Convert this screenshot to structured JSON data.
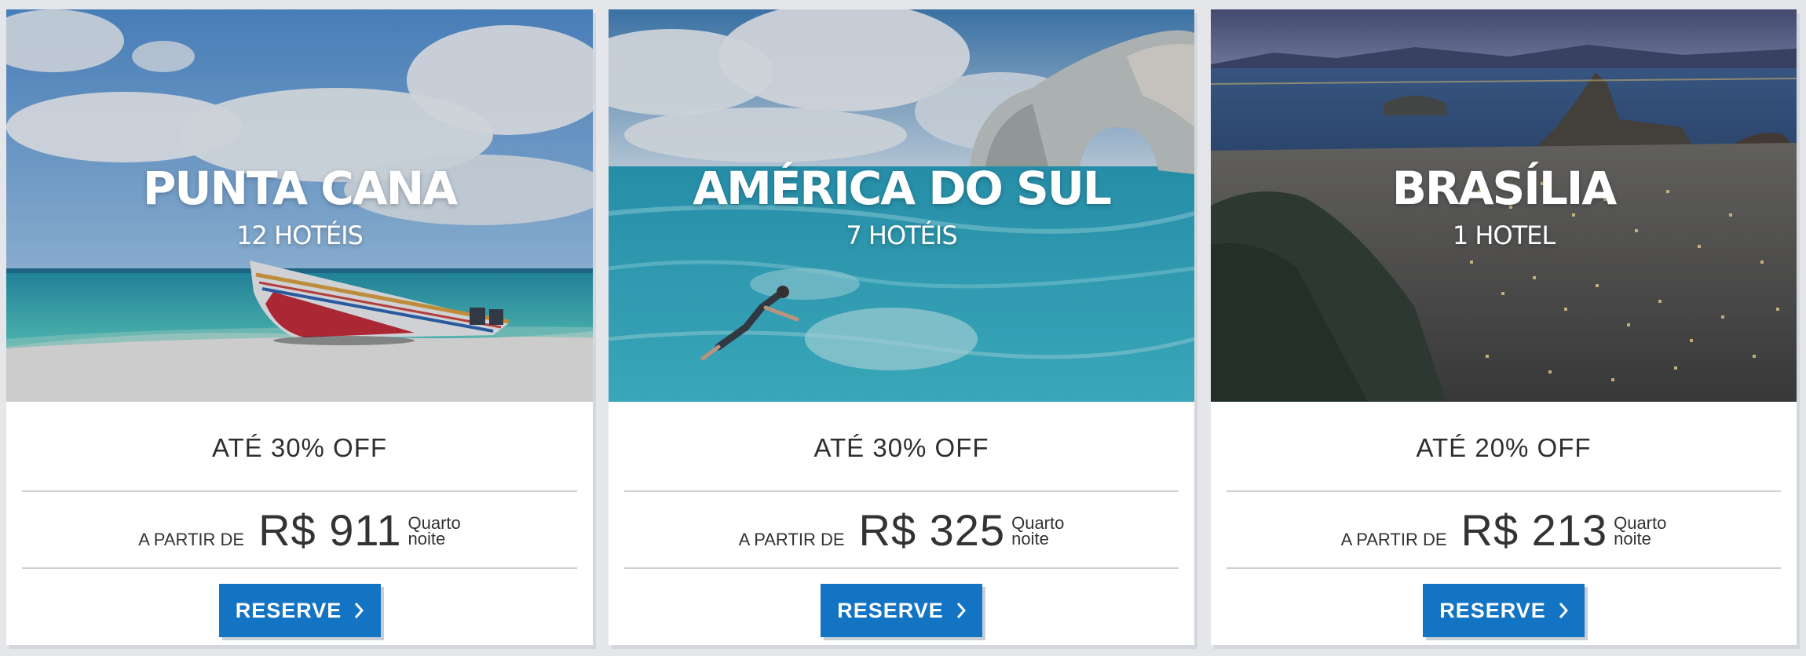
{
  "destinations": [
    {
      "name": "PUNTA CANA",
      "hotels": "12 HOTÉIS",
      "offer": "ATÉ 30% OFF",
      "from_label": "A PARTIR DE",
      "price": "R$ 911",
      "unit_line1": "Quarto",
      "unit_line2": "noite",
      "button_label": "RESERVE",
      "image": "beach-boat-photo"
    },
    {
      "name": "AMÉRICA DO SUL",
      "hotels": "7 HOTÉIS",
      "offer": "ATÉ 30% OFF",
      "from_label": "A PARTIR DE",
      "price": "R$ 325",
      "unit_line1": "Quarto",
      "unit_line2": "noite",
      "button_label": "RESERVE",
      "image": "sea-arch-swimmer-photo"
    },
    {
      "name": "BRASÍLIA",
      "hotels": "1 HOTEL",
      "offer": "ATÉ 20% OFF",
      "from_label": "A PARTIR DE",
      "price": "R$ 213",
      "unit_line1": "Quarto",
      "unit_line2": "noite",
      "button_label": "RESERVE",
      "image": "city-night-bay-photo"
    }
  ],
  "colors": {
    "button": "#1474c4",
    "text": "#333333",
    "rule": "#cfcfcf",
    "background": "#e4e6ea"
  }
}
